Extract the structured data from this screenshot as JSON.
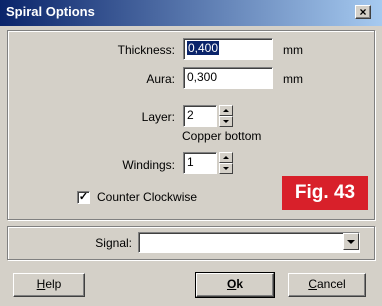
{
  "window": {
    "title": "Spiral Options",
    "close_glyph": "×"
  },
  "fields": {
    "thickness": {
      "label": "Thickness:",
      "value": "0,400",
      "unit": "mm"
    },
    "aura": {
      "label": "Aura:",
      "value": "0,300",
      "unit": "mm"
    },
    "layer": {
      "label": "Layer:",
      "value": "2",
      "layer_name": "Copper bottom"
    },
    "windings": {
      "label": "Windings:",
      "value": "1"
    }
  },
  "counter_clockwise": {
    "label": "Counter Clockwise",
    "checked": true,
    "mark": "✓"
  },
  "figure_badge": {
    "text": "Fig. 43",
    "color": "#d8202a"
  },
  "signal": {
    "label": "Signal:",
    "value": ""
  },
  "buttons": {
    "help": {
      "label_prefix": "",
      "label_underline": "H",
      "label_rest": "elp"
    },
    "ok": {
      "label_prefix": "",
      "label_underline": "O",
      "label_rest": "k"
    },
    "cancel": {
      "label_prefix": "",
      "label_underline": "C",
      "label_rest": "ancel"
    }
  },
  "icons": {
    "close": "close-icon",
    "spin_up": "arrow-up-icon",
    "spin_down": "arrow-down-icon",
    "dropdown": "chevron-down-icon"
  }
}
